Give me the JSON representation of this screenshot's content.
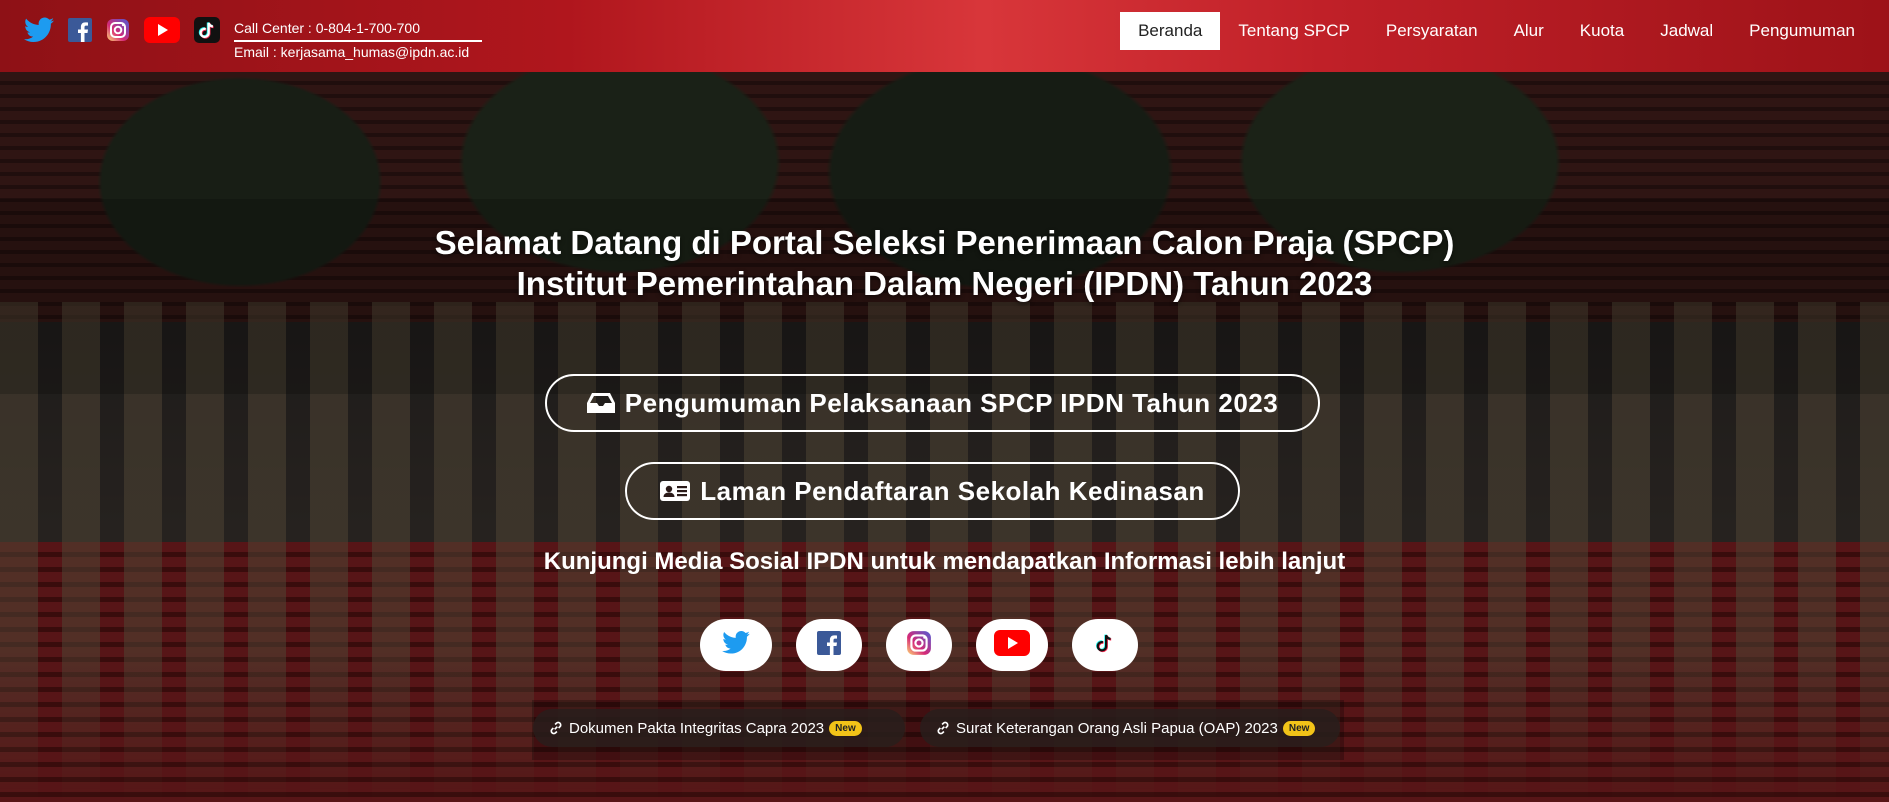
{
  "header": {
    "social_icons": [
      "twitter-icon",
      "facebook-icon",
      "instagram-icon",
      "youtube-icon",
      "tiktok-icon"
    ],
    "call_center": "Call Center : 0-804-1-700-700",
    "email": "Email : kerjasama_humas@ipdn.ac.id",
    "nav": [
      {
        "label": "Beranda",
        "active": true
      },
      {
        "label": "Tentang SPCP"
      },
      {
        "label": "Persyaratan"
      },
      {
        "label": "Alur"
      },
      {
        "label": "Kuota"
      },
      {
        "label": "Jadwal"
      },
      {
        "label": "Pengumuman"
      }
    ]
  },
  "hero": {
    "title_line1": "Selamat Datang di Portal Seleksi Penerimaan Calon Praja (SPCP)",
    "title_line2": "Institut Pemerintahan Dalam Negeri (IPDN) Tahun 2023",
    "button1": {
      "label": "Pengumuman Pelaksanaan SPCP IPDN Tahun 2023",
      "icon": "inbox-icon"
    },
    "button2": {
      "label": "Laman Pendaftaran Sekolah Kedinasan",
      "icon": "id-card-icon"
    },
    "visit_text": "Kunjungi Media Sosial IPDN untuk mendapatkan Informasi lebih lanjut",
    "social_buttons": [
      "twitter-icon",
      "facebook-icon",
      "instagram-icon",
      "youtube-icon",
      "tiktok-icon"
    ]
  },
  "documents": [
    {
      "label": "Dokumen Pakta Integritas Capra 2023",
      "badge": "New"
    },
    {
      "label": "Surat Keterangan Orang Asli Papua (OAP) 2023",
      "badge": "New"
    }
  ],
  "colors": {
    "header_red": "#b0161d",
    "twitter": "#1d9bf0",
    "facebook": "#3b5998",
    "youtube": "#ff0000",
    "badge": "#f2c318"
  }
}
